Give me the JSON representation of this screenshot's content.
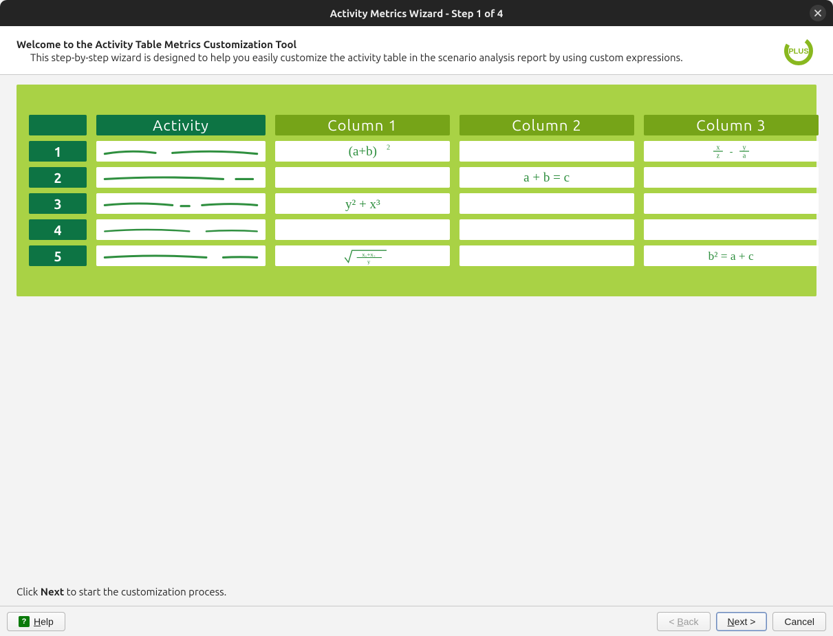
{
  "window": {
    "title": "Activity Metrics Wizard - Step 1 of 4"
  },
  "header": {
    "title": "Welcome to the Activity Table Metrics Customization Tool",
    "subtitle": "This step-by-step wizard is designed to help you easily customize the activity table in the scenario analysis report by using custom expressions.",
    "logo_text": "PLUS"
  },
  "table": {
    "column_headers": [
      "Activity",
      "Column 1",
      "Column 2",
      "Column 3"
    ],
    "row_labels": [
      "1",
      "2",
      "3",
      "4",
      "5"
    ],
    "cells": {
      "r1_c1": "(a+b)²",
      "r1_c3": "x/z - y/a",
      "r2_c2": "a+b=c",
      "r3_c1": "y² + x³",
      "r5_c1": "√((x₁+x₂)/y)",
      "r5_c3": "b² = a+c"
    }
  },
  "instruction": {
    "prefix": "Click ",
    "bold": "Next",
    "suffix": " to start the customization process."
  },
  "buttons": {
    "help": "Help",
    "back": "< Back",
    "next": "Next >",
    "cancel": "Cancel"
  }
}
